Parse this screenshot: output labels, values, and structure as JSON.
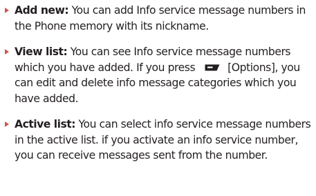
{
  "items": [
    {
      "term": "Add new:",
      "text": "You can add Info service message numbers in the Phone memory with its nickname."
    },
    {
      "term": "View list:",
      "text_before_icon": "You can see Info service message numbers which you have added. If you press",
      "icon": "left-soft-key-icon",
      "text_after_icon": "[Options], you can edit and delete info message categories which you have added."
    },
    {
      "term": "Active list:",
      "text": "You can select info service message numbers in the active list. if you activate an info service number, you can receive messages sent from the number."
    }
  ],
  "colors": {
    "bullet": "#d1544f",
    "text": "#231f20",
    "softkey": "#231f20"
  }
}
